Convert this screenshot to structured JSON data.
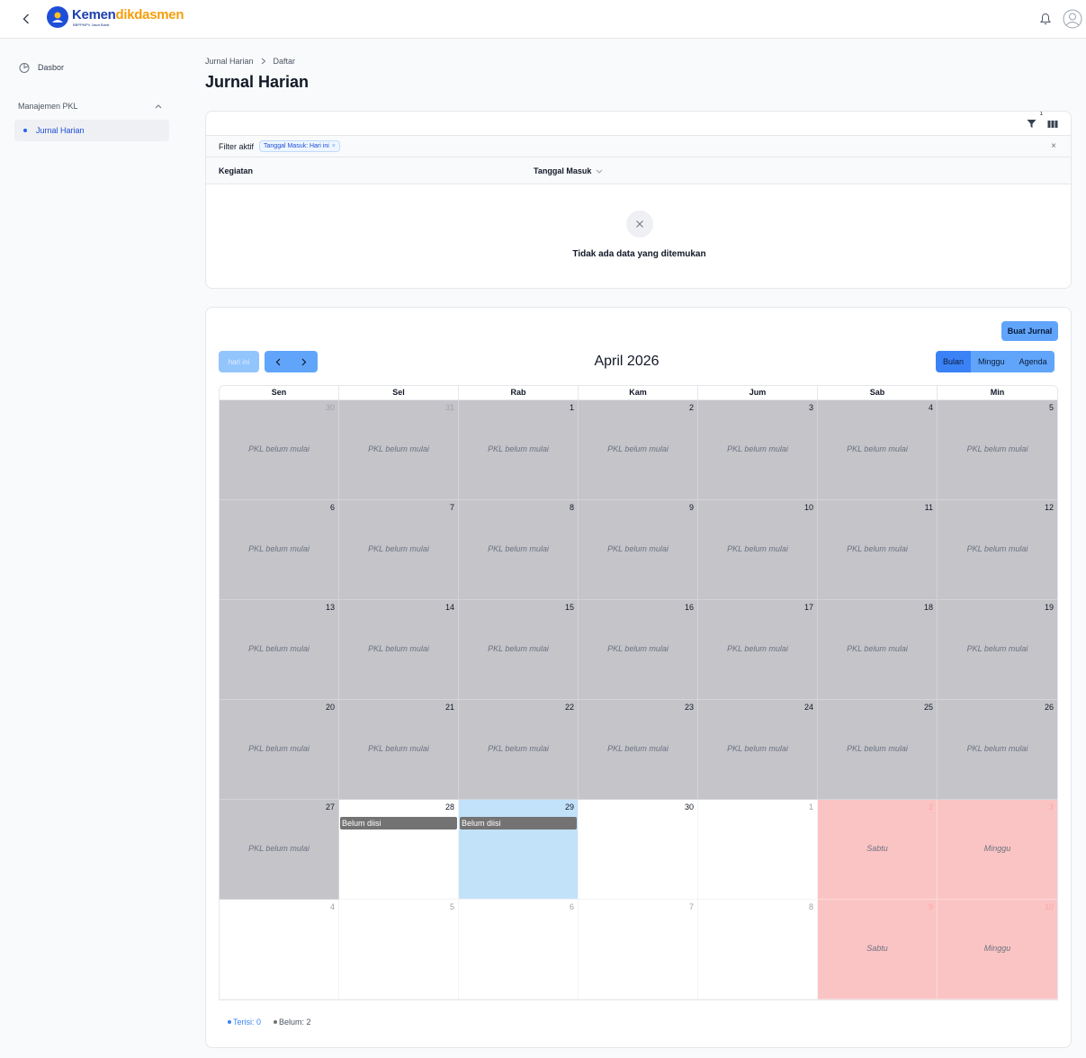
{
  "header": {
    "brand_part1": "Kemen",
    "brand_part2": "dikdasmen",
    "brand_sub": "BBPPMPV Jawa Barat",
    "back_icon": "chevron-left-icon",
    "notification_icon": "bell-icon",
    "user_icon": "user-circle-icon"
  },
  "sidebar": {
    "dasbor_label": "Dasbor",
    "group_label": "Manajemen PKL",
    "active_item_label": "Jurnal Harian"
  },
  "breadcrumb": {
    "parent": "Jurnal Harian",
    "current": "Daftar"
  },
  "page_title": "Jurnal Harian",
  "table": {
    "filter_count": "1",
    "filter_label": "Filter aktif",
    "filter_chip": "Tanggal Masuk: Hari ini",
    "clear_symbol": "×",
    "chip_remove_symbol": "×",
    "col_kegiatan": "Kegiatan",
    "col_tanggal": "Tanggal Masuk",
    "empty_text": "Tidak ada data yang ditemukan"
  },
  "calendar": {
    "create_label": "Buat Jurnal",
    "today_label": "hari ini",
    "month_title": "April 2026",
    "views": [
      "Bulan",
      "Minggu",
      "Agenda"
    ],
    "active_view": "Bulan",
    "weekdays": [
      "Sen",
      "Sel",
      "Rab",
      "Kam",
      "Jum",
      "Sab",
      "Min"
    ],
    "days": [
      {
        "num": "30",
        "state": "notstarted",
        "outside": true,
        "label": "PKL belum mulai"
      },
      {
        "num": "31",
        "state": "notstarted",
        "outside": true,
        "label": "PKL belum mulai"
      },
      {
        "num": "1",
        "state": "notstarted",
        "label": "PKL belum mulai"
      },
      {
        "num": "2",
        "state": "notstarted",
        "label": "PKL belum mulai"
      },
      {
        "num": "3",
        "state": "notstarted",
        "label": "PKL belum mulai"
      },
      {
        "num": "4",
        "state": "notstarted",
        "label": "PKL belum mulai"
      },
      {
        "num": "5",
        "state": "notstarted",
        "label": "PKL belum mulai"
      },
      {
        "num": "6",
        "state": "notstarted",
        "label": "PKL belum mulai"
      },
      {
        "num": "7",
        "state": "notstarted",
        "label": "PKL belum mulai"
      },
      {
        "num": "8",
        "state": "notstarted",
        "label": "PKL belum mulai"
      },
      {
        "num": "9",
        "state": "notstarted",
        "label": "PKL belum mulai"
      },
      {
        "num": "10",
        "state": "notstarted",
        "label": "PKL belum mulai"
      },
      {
        "num": "11",
        "state": "notstarted",
        "label": "PKL belum mulai"
      },
      {
        "num": "12",
        "state": "notstarted",
        "label": "PKL belum mulai"
      },
      {
        "num": "13",
        "state": "notstarted",
        "label": "PKL belum mulai"
      },
      {
        "num": "14",
        "state": "notstarted",
        "label": "PKL belum mulai"
      },
      {
        "num": "15",
        "state": "notstarted",
        "label": "PKL belum mulai"
      },
      {
        "num": "16",
        "state": "notstarted",
        "label": "PKL belum mulai"
      },
      {
        "num": "17",
        "state": "notstarted",
        "label": "PKL belum mulai"
      },
      {
        "num": "18",
        "state": "notstarted",
        "label": "PKL belum mulai"
      },
      {
        "num": "19",
        "state": "notstarted",
        "label": "PKL belum mulai"
      },
      {
        "num": "20",
        "state": "notstarted",
        "label": "PKL belum mulai"
      },
      {
        "num": "21",
        "state": "notstarted",
        "label": "PKL belum mulai"
      },
      {
        "num": "22",
        "state": "notstarted",
        "label": "PKL belum mulai"
      },
      {
        "num": "23",
        "state": "notstarted",
        "label": "PKL belum mulai"
      },
      {
        "num": "24",
        "state": "notstarted",
        "label": "PKL belum mulai"
      },
      {
        "num": "25",
        "state": "notstarted",
        "label": "PKL belum mulai"
      },
      {
        "num": "26",
        "state": "notstarted",
        "label": "PKL belum mulai"
      },
      {
        "num": "27",
        "state": "notstarted",
        "label": "PKL belum mulai"
      },
      {
        "num": "28",
        "state": "normal",
        "event": "Belum diisi"
      },
      {
        "num": "29",
        "state": "today",
        "event": "Belum diisi"
      },
      {
        "num": "30",
        "state": "normal"
      },
      {
        "num": "1",
        "state": "normal",
        "outside": true
      },
      {
        "num": "2",
        "state": "weekend",
        "outside": true,
        "label": "Sabtu"
      },
      {
        "num": "3",
        "state": "weekend",
        "outside": true,
        "label": "Minggu"
      },
      {
        "num": "4",
        "state": "normal",
        "outside": true
      },
      {
        "num": "5",
        "state": "normal",
        "outside": true
      },
      {
        "num": "6",
        "state": "normal",
        "outside": true
      },
      {
        "num": "7",
        "state": "normal",
        "outside": true
      },
      {
        "num": "8",
        "state": "normal",
        "outside": true
      },
      {
        "num": "9",
        "state": "weekend",
        "outside": true,
        "label": "Sabtu"
      },
      {
        "num": "10",
        "state": "weekend",
        "outside": true,
        "label": "Minggu"
      }
    ],
    "legend": [
      {
        "label": "Terisi: 0",
        "color": "#3b82f6"
      },
      {
        "label": "Belum: 2",
        "color": "#737373"
      }
    ]
  },
  "colors": {
    "accent": "#60a5fa",
    "not_started": "#c4c4c9",
    "weekend": "#fbc4c4",
    "today": "#c2e2f9",
    "event": "#737373"
  }
}
